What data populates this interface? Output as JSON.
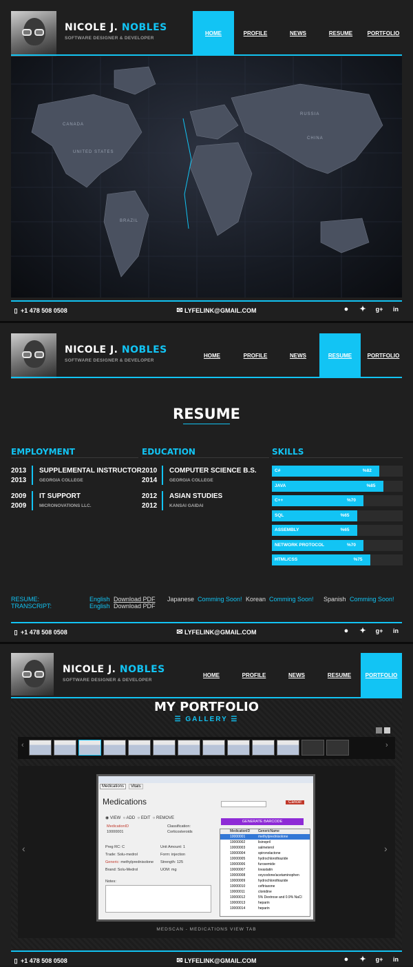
{
  "profile": {
    "first_name": "NICOLE J.",
    "last_name": "NOBLES",
    "tagline": "SOFTWARE DESIGNER & DEVELOPER"
  },
  "nav": [
    "HOME",
    "PROFILE",
    "NEWS",
    "RESUME",
    "PORTFOLIO"
  ],
  "footer": {
    "phone": "+1 478 508 0508",
    "email": "LYFELINK@GMAIL.COM",
    "socials": [
      "github-icon",
      "twitter-icon",
      "google-plus-icon",
      "linkedin-icon"
    ]
  },
  "map": {
    "labels": [
      "CANADA",
      "UNITED STATES",
      "RUSSIA",
      "CHINA",
      "BRAZIL"
    ]
  },
  "resume": {
    "title": "RESUME",
    "employment": {
      "heading": "EMPLOYMENT",
      "items": [
        {
          "start": "2013",
          "end": "2013",
          "title": "SUPPLEMENTAL INSTRUCTOR",
          "org": "GEORGIA COLLEGE"
        },
        {
          "start": "2009",
          "end": "2009",
          "title": "IT SUPPORT",
          "org": "MICRONOVATIONS LLC."
        }
      ]
    },
    "education": {
      "heading": "EDUCATION",
      "items": [
        {
          "start": "2010",
          "end": "2014",
          "title": "COMPUTER SCIENCE B.S.",
          "org": "GEORGIA COLLEGE"
        },
        {
          "start": "2012",
          "end": "2012",
          "title": "ASIAN STUDIES",
          "org": "KANSAI GAIDAI"
        }
      ]
    },
    "skills": {
      "heading": "SKILLS",
      "items": [
        {
          "name": "C#",
          "pct_label": "%82",
          "value": 82
        },
        {
          "name": "JAVA",
          "pct_label": "%85",
          "value": 85
        },
        {
          "name": "C++",
          "pct_label": "%70",
          "value": 70
        },
        {
          "name": "SQL",
          "pct_label": "%65",
          "value": 65
        },
        {
          "name": "ASSEMBLY",
          "pct_label": "%65",
          "value": 65
        },
        {
          "name": "NETWORK PROTOCOL",
          "pct_label": "%70",
          "value": 70
        },
        {
          "name": "HTML/CSS",
          "pct_label": "%75",
          "value": 75
        }
      ]
    },
    "downloads": {
      "resume_label": "RESUME:",
      "transcript_label": "TRANSCRIPT:",
      "english": "English",
      "download_pdf": "Download PDF",
      "japanese": "Japanese",
      "korean": "Korean",
      "spanish": "Spanish",
      "coming_soon": "Comming Soon!"
    }
  },
  "portfolio": {
    "title": "MY PORTFOLIO",
    "subtitle": "GALLERY",
    "caption": "MEDSCAN - MEDICATIONS VIEW TAB",
    "screenshot": {
      "tab1": "Medications",
      "tab2": "Vitals",
      "heading": "Medications",
      "cancel": "Cancel",
      "view": "VIEW",
      "add": "ADD",
      "edit": "EDIT",
      "remove": "REMOVE",
      "generate": "GENERATE BARCODE",
      "med_id_label": "MedicationID",
      "med_id": "10000001",
      "class_label": "Classification:",
      "class_value": "Corticosteroids",
      "preg_label": "Preg RC:",
      "preg_value": "C",
      "unit_label": "Unit Amount:",
      "unit_value": "1",
      "trade_label": "Trade:",
      "trade_value": "Solu-medrol",
      "form_label": "Form:",
      "form_value": "injection",
      "generic_label": "Generic:",
      "generic_value": "methylprednisolone",
      "strength_label": "Strength:",
      "strength_value": "125",
      "brand_label": "Brand:",
      "brand_value": "Solu-Medrol",
      "uom_label": "UOM:",
      "uom_value": "mg",
      "notes_label": "Notes:",
      "col1": "MedicationID",
      "col2": "GenericName",
      "rows": [
        [
          "10000001",
          "methylprednisolone"
        ],
        [
          "10000002",
          "lisinopril"
        ],
        [
          "10000003",
          "salmeterol"
        ],
        [
          "10000004",
          "spironolactone"
        ],
        [
          "10000005",
          "hydrochlorothiazide"
        ],
        [
          "10000006",
          "furosemide"
        ],
        [
          "10000007",
          "lovastatin"
        ],
        [
          "10000008",
          "oxycodone/acetaminophen"
        ],
        [
          "10000009",
          "hydrochlorothiazide"
        ],
        [
          "10000010",
          "ceftriaxone"
        ],
        [
          "10000011",
          "clonidine"
        ],
        [
          "10000012",
          "5% Dextrose and 0.9% NaCl"
        ],
        [
          "10000013",
          "heparin"
        ],
        [
          "10000014",
          "heparin"
        ]
      ]
    }
  },
  "colors": {
    "accent": "#12c4f4",
    "background": "#1f1f1f"
  }
}
